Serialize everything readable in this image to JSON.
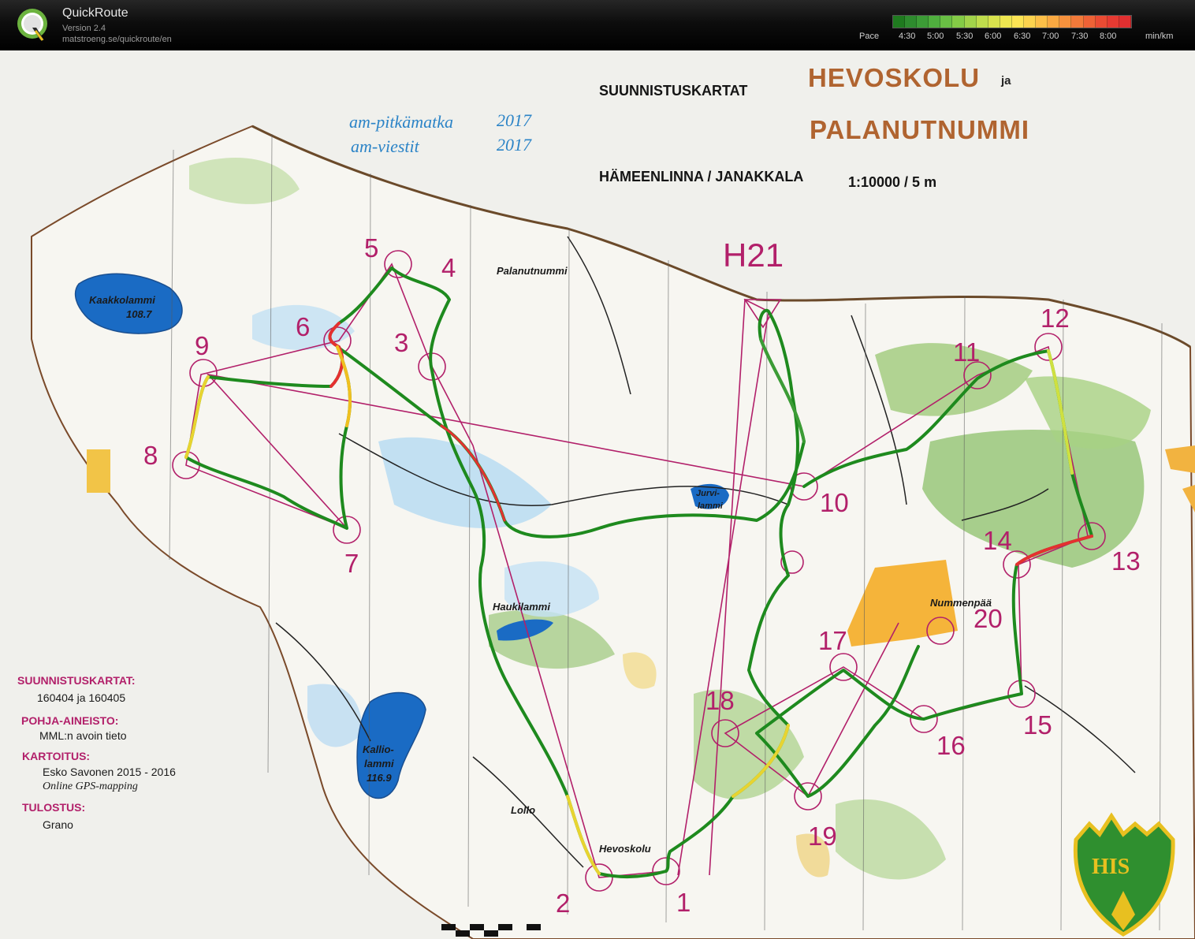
{
  "app": {
    "title": "QuickRoute",
    "version": "Version 2.4",
    "url": "matstroeng.se/quickroute/en",
    "logo_letter": "Q"
  },
  "pace": {
    "label": "Pace",
    "ticks": [
      "4:30",
      "5:00",
      "5:30",
      "6:00",
      "6:30",
      "7:00",
      "7:30",
      "8:00"
    ],
    "unit": "min/km",
    "colors": [
      "#1f7a1f",
      "#2e8b2e",
      "#3c9c36",
      "#4faf3e",
      "#69bf44",
      "#84cb46",
      "#a2d34a",
      "#bfdc4c",
      "#d8e24d",
      "#eee650",
      "#fce454",
      "#fcd34e",
      "#fcbf48",
      "#f9a942",
      "#f6913d",
      "#f27a3a",
      "#ee6236",
      "#ea4b33",
      "#e63a32",
      "#e12f30"
    ]
  },
  "map": {
    "title_main": "SUUNNISTUSKARTAT",
    "name1": "HEVOSKOLU",
    "ja": "ja",
    "name2": "PALANUTNUMMI",
    "place": "HÄMEENLINNA / JANAKKALA",
    "scale": "1:10000 / 5 m",
    "event1_name": "am-pitkämatka",
    "event1_year": "2017",
    "event2_name": "am-viestit",
    "event2_year": "2017",
    "class": "H21",
    "place_labels": {
      "palanutnummi": "Palanutnummi",
      "nummenpaa": "Nummenpää",
      "hevoskolu": "Hevoskolu",
      "lollo": "Lollo"
    },
    "lakes": {
      "kaakkolammi": "Kaakkolammi",
      "kaakkolammi_alt": "108.7",
      "jurvi1": "Jurvi-",
      "jurvi2": "lammi",
      "haukilammi": "Haukilammi",
      "kallio1": "Kallio-",
      "kallio2": "lammi",
      "kallio_alt": "116.9"
    },
    "controls": [
      "1",
      "2",
      "3",
      "4",
      "5",
      "6",
      "7",
      "8",
      "9",
      "10",
      "11",
      "12",
      "13",
      "14",
      "15",
      "16",
      "17",
      "18",
      "19",
      "20"
    ],
    "legend": {
      "h1": "SUUNNISTUSKARTAT:",
      "t1": "160404 ja 160405",
      "h2": "POHJA-AINEISTO:",
      "t2": "MML:n avoin tieto",
      "h3": "KARTOITUS:",
      "t3a": "Esko Savonen  2015 - 2016",
      "t3b": "Online GPS-mapping",
      "h4": "TULOSTUS:",
      "t4": "Grano"
    },
    "club_logo": "HIS"
  }
}
